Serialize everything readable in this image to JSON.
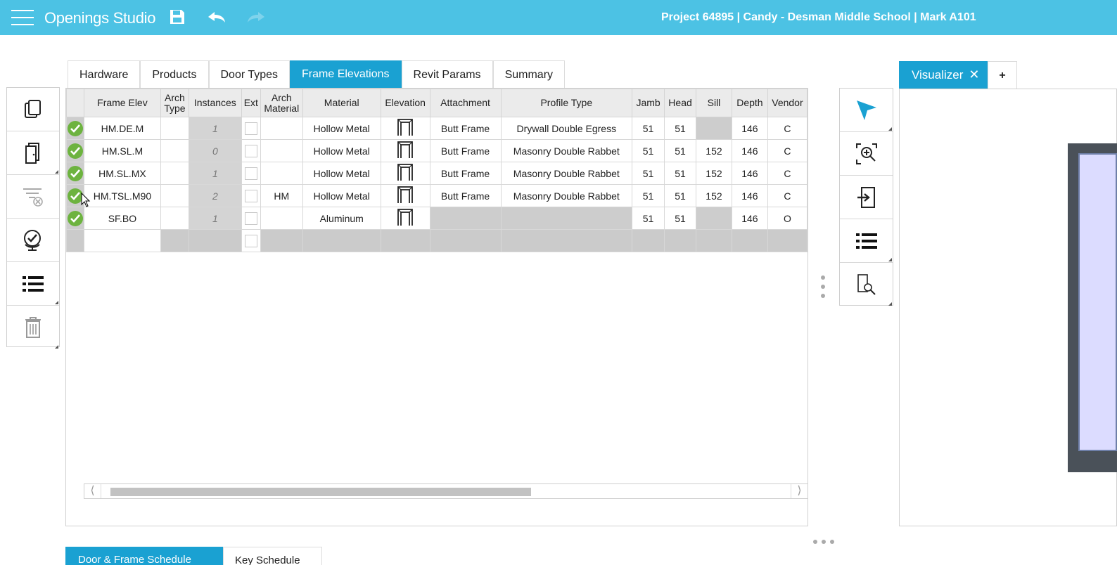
{
  "app": {
    "title": "Openings Studio",
    "project": "Project 64895 | Candy - Desman Middle School | Mark A101"
  },
  "toolbar": {
    "icons": [
      "menu-icon",
      "save-icon",
      "undo-icon",
      "redo-icon"
    ]
  },
  "tabs": [
    {
      "label": "Hardware"
    },
    {
      "label": "Products"
    },
    {
      "label": "Door Types"
    },
    {
      "label": "Frame Elevations",
      "active": true
    },
    {
      "label": "Revit Params"
    },
    {
      "label": "Summary"
    }
  ],
  "left_toolbar": [
    "copy-icon",
    "door-copies-icon",
    "clear-filter-icon",
    "verify-globe-icon",
    "list-icon",
    "trash-icon"
  ],
  "grid": {
    "headers": [
      "",
      "Frame Elev",
      "Arch Type",
      "Instances",
      "Ext",
      "Arch Material",
      "Material",
      "Elevation",
      "Attachment",
      "Profile Type",
      "Jamb",
      "Head",
      "Sill",
      "Depth",
      "Vendor"
    ],
    "rows": [
      {
        "name": "HM.DE.M",
        "arch_type": "",
        "instances": "1",
        "arch_material": "",
        "material": "Hollow Metal",
        "attachment": "Butt Frame",
        "profile": "Drywall Double Egress",
        "jamb": "51",
        "head": "51",
        "sill": "",
        "depth": "146",
        "vendor": "C"
      },
      {
        "name": "HM.SL.M",
        "arch_type": "",
        "instances": "0",
        "arch_material": "",
        "material": "Hollow Metal",
        "attachment": "Butt Frame",
        "profile": "Masonry Double Rabbet",
        "jamb": "51",
        "head": "51",
        "sill": "152",
        "depth": "146",
        "vendor": "C"
      },
      {
        "name": "HM.SL.MX",
        "arch_type": "",
        "instances": "1",
        "arch_material": "",
        "material": "Hollow Metal",
        "attachment": "Butt Frame",
        "profile": "Masonry Double Rabbet",
        "jamb": "51",
        "head": "51",
        "sill": "152",
        "depth": "146",
        "vendor": "C"
      },
      {
        "name": "HM.TSL.M90",
        "arch_type": "",
        "instances": "2",
        "arch_material": "HM",
        "material": "Hollow Metal",
        "attachment": "Butt Frame",
        "profile": "Masonry Double Rabbet",
        "jamb": "51",
        "head": "51",
        "sill": "152",
        "depth": "146",
        "vendor": "C"
      },
      {
        "name": "SF.BO",
        "arch_type": "",
        "instances": "1",
        "arch_material": "",
        "material": "Aluminum",
        "attachment": "",
        "profile": "",
        "jamb": "51",
        "head": "51",
        "sill": "",
        "depth": "146",
        "vendor": "O"
      }
    ]
  },
  "right_toolbar": [
    "select-arrow-icon",
    "zoom-extents-icon",
    "import-icon",
    "list-icon",
    "door-search-icon"
  ],
  "visualizer": {
    "tab_label": "Visualizer",
    "close": "✕",
    "add": "+"
  },
  "bottom_tabs": [
    {
      "label": "Door & Frame Schedule"
    },
    {
      "label": "Key Schedule"
    }
  ],
  "colors": {
    "topbar": "#4cc2e4",
    "active_tab": "#1aa1d2",
    "check": "#6db33f"
  }
}
